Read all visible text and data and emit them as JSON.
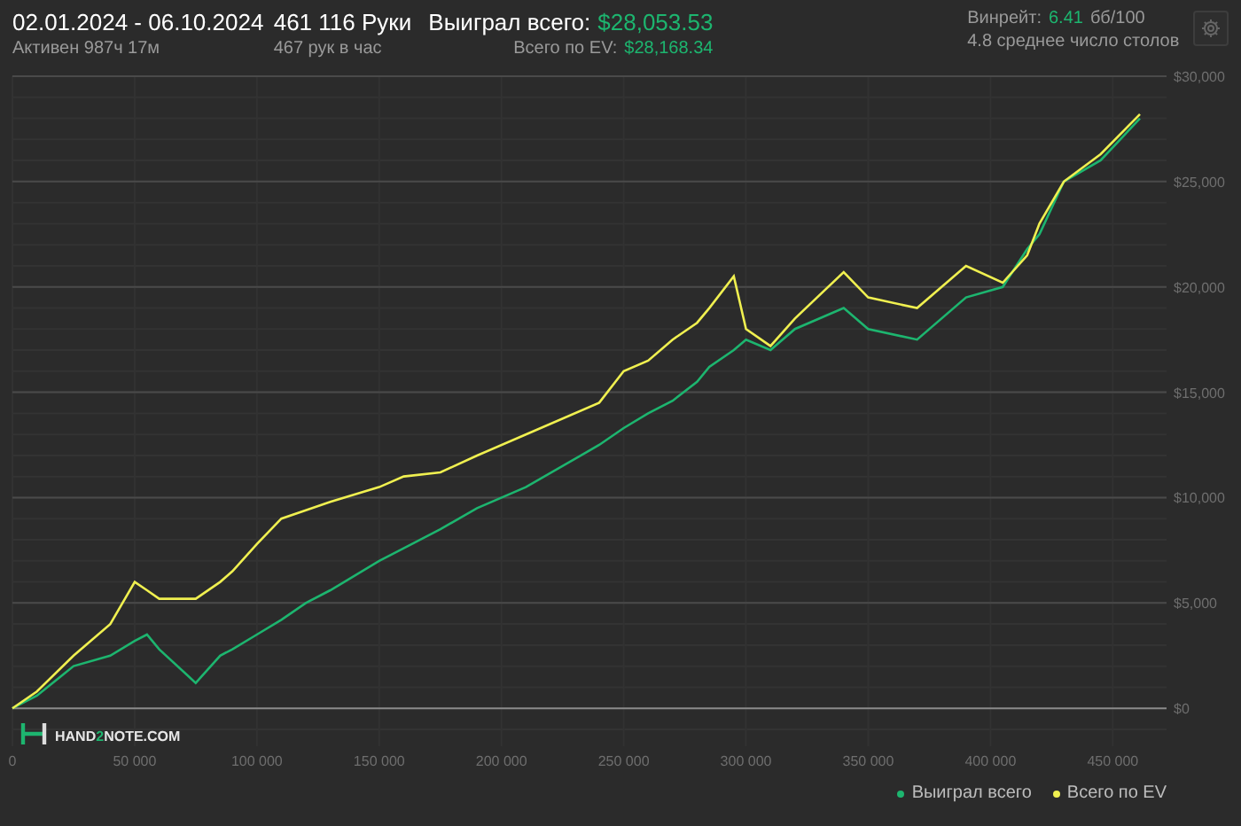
{
  "header": {
    "date_range": "02.01.2024 - 06.10.2024",
    "active": "Активен 987ч 17м",
    "hands": "461 116 Руки",
    "hands_per_hour": "467 рук в час",
    "won_label": "Выиграл всего:",
    "won_value": "$28,053.53",
    "ev_label": "Всего по EV:",
    "ev_value": "$28,168.34",
    "winrate_label": "Винрейт:",
    "winrate_value": "6.41",
    "winrate_unit": "бб/100",
    "tables": "4.8 среднее число столов"
  },
  "logo": {
    "parts": [
      {
        "text": "HAND",
        "accent": false
      },
      {
        "text": "2",
        "accent": true
      },
      {
        "text": "NOTE.COM",
        "accent": false
      }
    ]
  },
  "chart_data": {
    "type": "line",
    "grid": true,
    "xlim": [
      0,
      472000
    ],
    "ylim": [
      -1800,
      30000
    ],
    "xticks": [
      {
        "value": 0,
        "label": "0"
      },
      {
        "value": 50000,
        "label": "50 000"
      },
      {
        "value": 100000,
        "label": "100 000"
      },
      {
        "value": 150000,
        "label": "150 000"
      },
      {
        "value": 200000,
        "label": "200 000"
      },
      {
        "value": 250000,
        "label": "250 000"
      },
      {
        "value": 300000,
        "label": "300 000"
      },
      {
        "value": 350000,
        "label": "350 000"
      },
      {
        "value": 400000,
        "label": "400 000"
      },
      {
        "value": 450000,
        "label": "450 000"
      }
    ],
    "yticks": [
      {
        "value": 0,
        "label": "$0"
      },
      {
        "value": 5000,
        "label": "$5,000"
      },
      {
        "value": 10000,
        "label": "$10,000"
      },
      {
        "value": 15000,
        "label": "$15,000"
      },
      {
        "value": 20000,
        "label": "$20,000"
      },
      {
        "value": 25000,
        "label": "$25,000"
      },
      {
        "value": 30000,
        "label": "$30,000"
      }
    ],
    "x": [
      0,
      10000,
      25000,
      40000,
      50000,
      55000,
      60000,
      75000,
      85000,
      90000,
      100000,
      110000,
      120000,
      130000,
      150000,
      160000,
      175000,
      190000,
      210000,
      240000,
      250000,
      260000,
      270000,
      280000,
      285000,
      295000,
      300000,
      310000,
      320000,
      340000,
      350000,
      370000,
      390000,
      405000,
      415000,
      420000,
      430000,
      445000,
      461116
    ],
    "series": [
      {
        "name": "Выиграл всего",
        "color": "#1db56f",
        "values": [
          0,
          600,
          2000,
          2500,
          3200,
          3500,
          2800,
          1200,
          2500,
          2800,
          3500,
          4200,
          5000,
          5600,
          7000,
          7600,
          8500,
          9500,
          10500,
          12500,
          13300,
          14000,
          14600,
          15500,
          16200,
          17000,
          17500,
          17000,
          18000,
          19000,
          18000,
          17500,
          19500,
          20000,
          21800,
          22500,
          25000,
          26000,
          28000
        ]
      },
      {
        "name": "Всего по EV",
        "color": "#f0f050",
        "values": [
          0,
          800,
          2500,
          4000,
          6000,
          5600,
          5200,
          5200,
          6000,
          6500,
          7800,
          9000,
          9400,
          9800,
          10500,
          11000,
          11200,
          12000,
          13000,
          14500,
          16000,
          16500,
          17500,
          18300,
          19000,
          20500,
          18000,
          17200,
          18500,
          20700,
          19500,
          19000,
          21000,
          20200,
          21500,
          23000,
          25000,
          26300,
          28200
        ]
      }
    ]
  }
}
